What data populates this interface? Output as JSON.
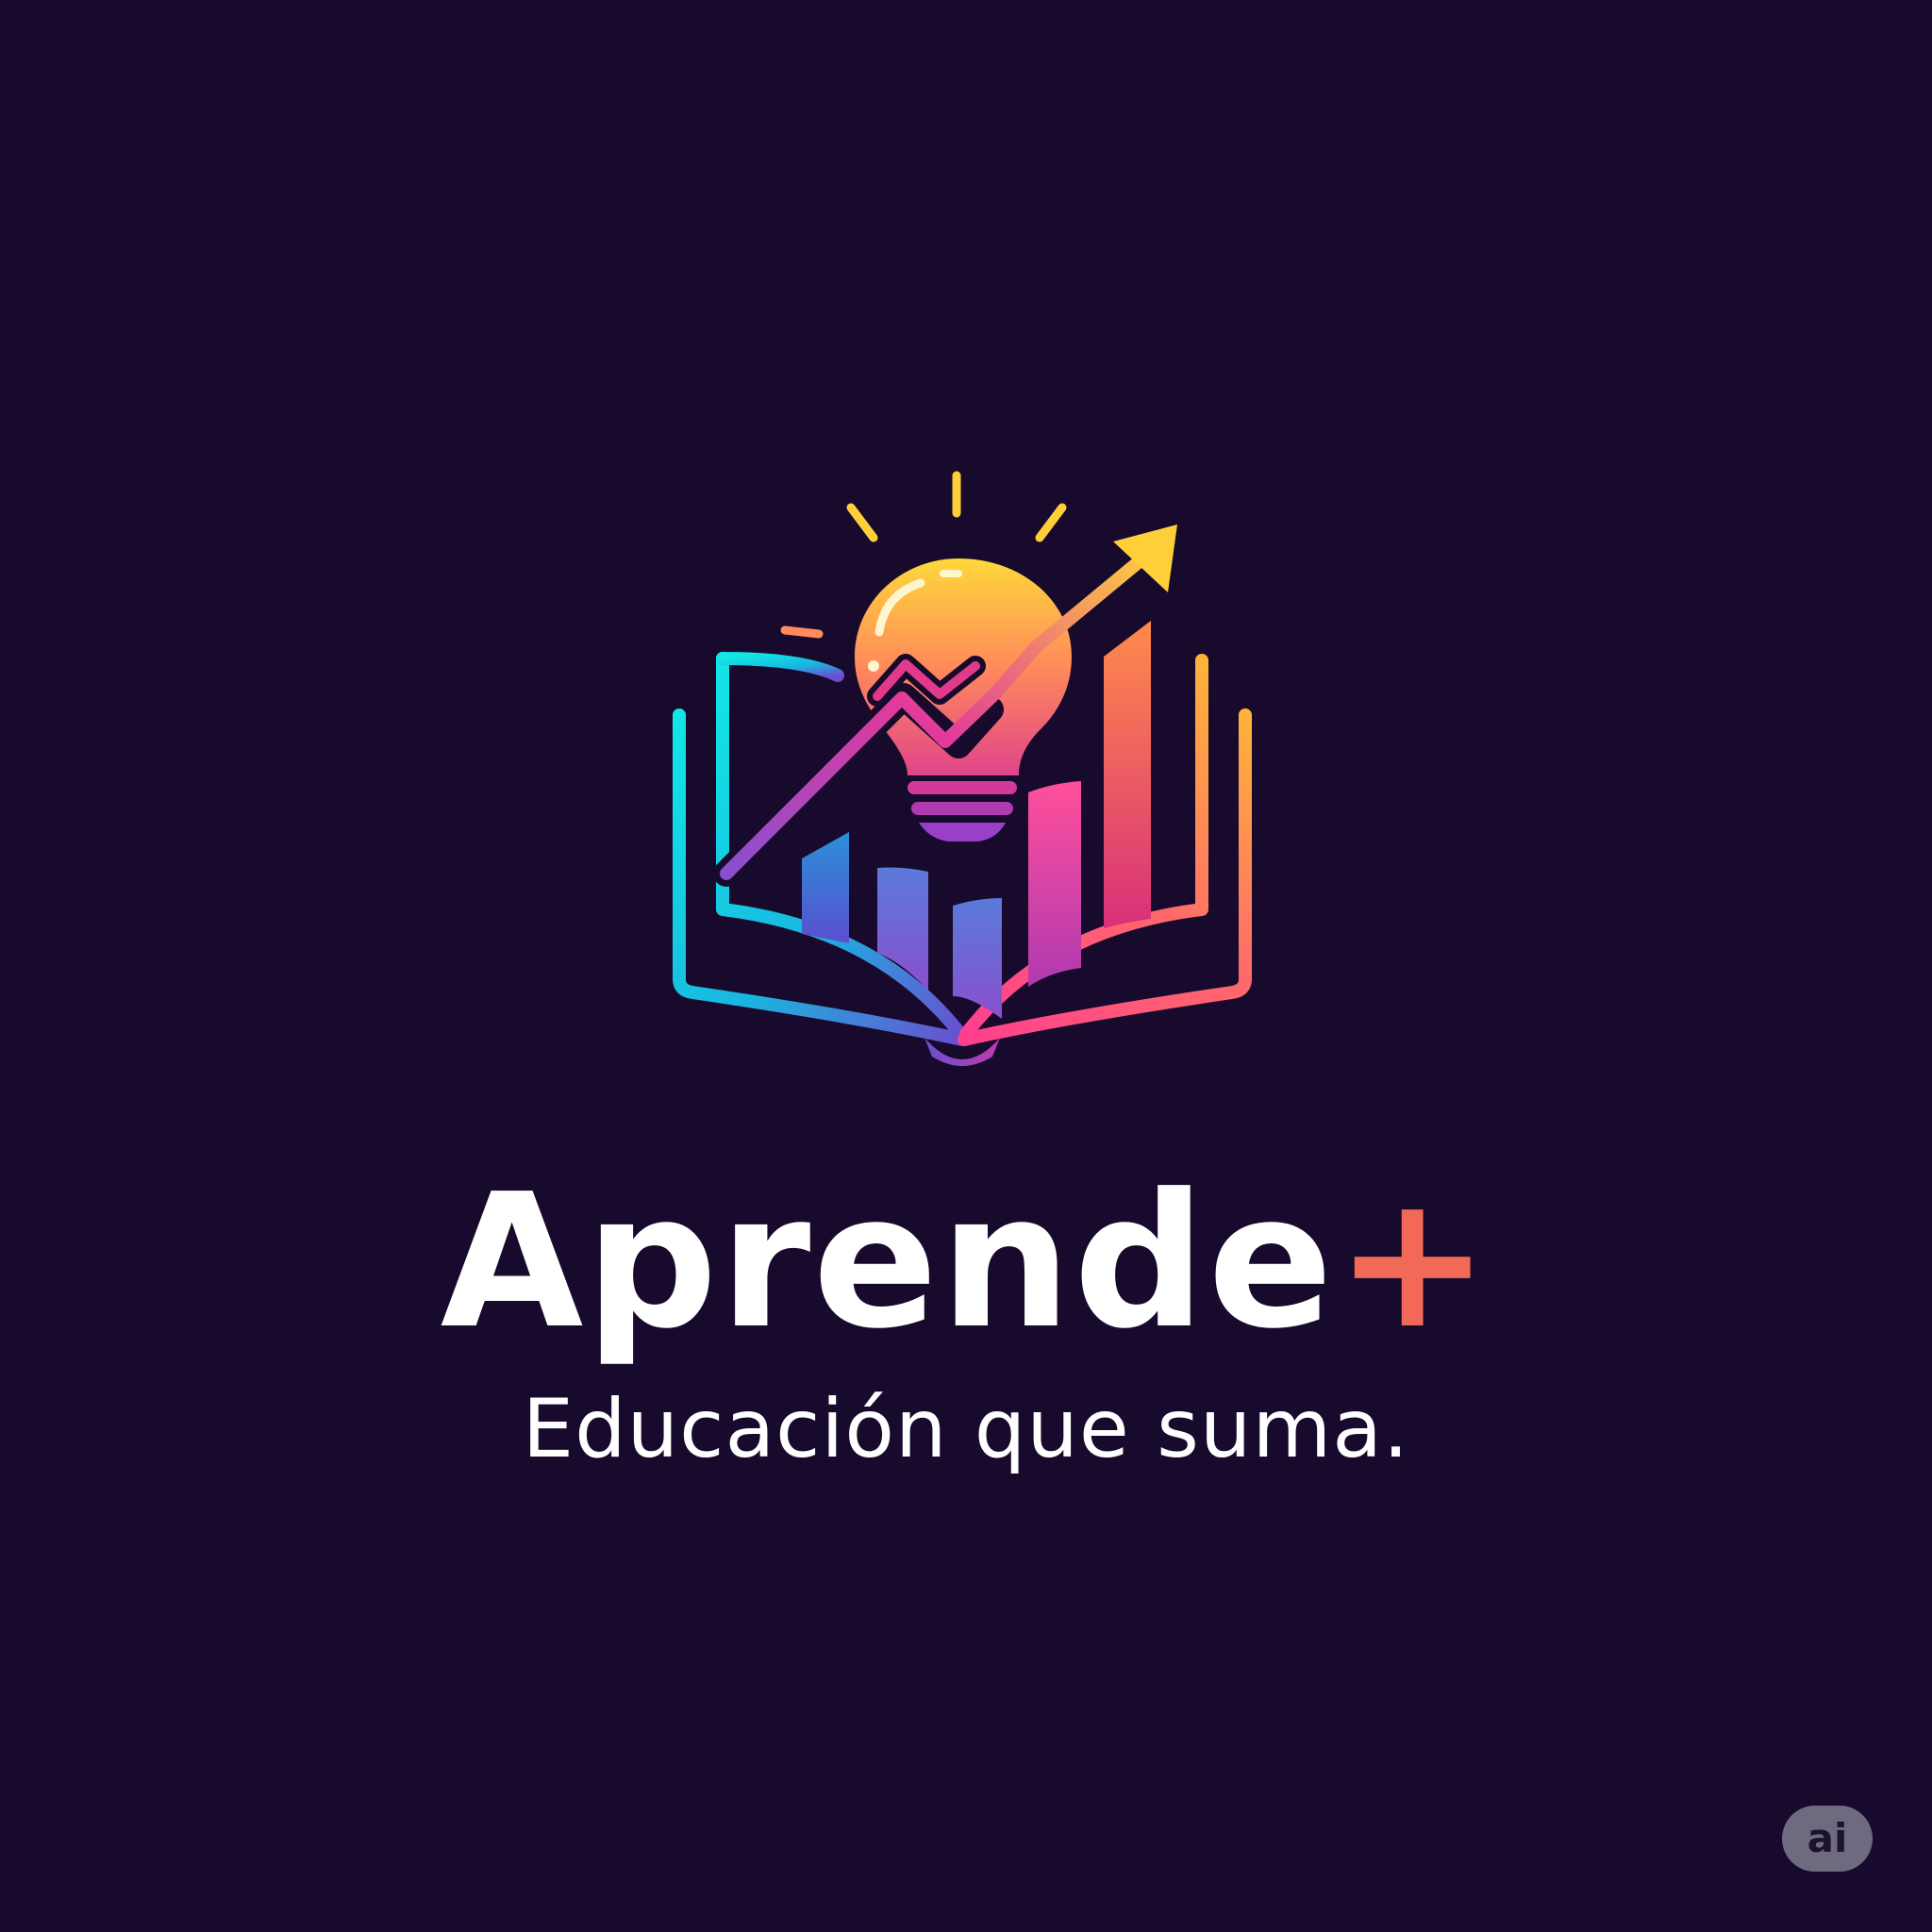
{
  "brand": {
    "name": "Aprende",
    "plus_sign": "+",
    "tagline": "Educación que suma."
  },
  "badge": {
    "label": "ai"
  },
  "colors": {
    "background": "#170a2c",
    "wordmark": "#ffffff",
    "plus_accent": "#f26a57",
    "gradient_cyan": "#12e6e6",
    "gradient_purple": "#8a4fd0",
    "gradient_pink": "#ff3f8e",
    "gradient_yellow": "#ffd83a",
    "gradient_orange": "#ff8a3d"
  },
  "logo": {
    "icons": [
      "open-book-icon",
      "lightbulb-icon",
      "bar-chart-icon",
      "trend-arrow-icon"
    ]
  }
}
